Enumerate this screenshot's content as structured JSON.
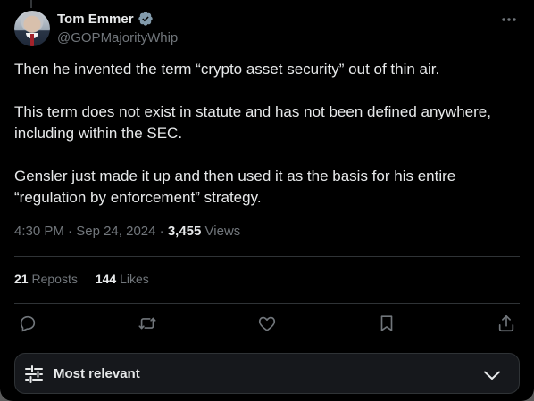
{
  "author": {
    "name": "Tom Emmer",
    "handle": "@GOPMajorityWhip",
    "verified": true
  },
  "post": {
    "paragraphs": [
      "Then he invented the term “crypto asset security” out of thin air.",
      "This term does not exist in statute and has not been defined anywhere, including within the SEC.",
      "Gensler just made it up and then used it as the basis for his entire “regulation by enforcement” strategy."
    ],
    "time": "4:30 PM",
    "date": "Sep 24, 2024",
    "views_count": "3,455",
    "views_label": "Views"
  },
  "stats": {
    "reposts_count": "21",
    "reposts_label": "Reposts",
    "likes_count": "144",
    "likes_label": "Likes"
  },
  "actions": [
    "reply-icon",
    "repost-icon",
    "like-icon",
    "bookmark-icon",
    "share-icon"
  ],
  "sort": {
    "label": "Most relevant"
  },
  "colors": {
    "background": "#000000",
    "text": "#e7e9ea",
    "muted": "#71767b",
    "verified": "#829aab",
    "divider": "#2f3336"
  }
}
